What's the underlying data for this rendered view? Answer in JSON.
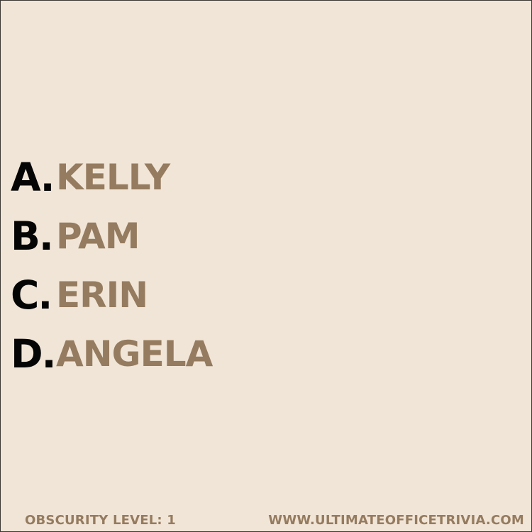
{
  "options": [
    {
      "letter": "A.",
      "answer": "KELLY"
    },
    {
      "letter": "B.",
      "answer": "PAM"
    },
    {
      "letter": "C.",
      "answer": "ERIN"
    },
    {
      "letter": "D.",
      "answer": "ANGELA"
    }
  ],
  "footer": {
    "obscurity": "OBSCURITY LEVEL: 1",
    "website": "WWW.ULTIMATEOFFICETRIVIA.COM"
  },
  "colors": {
    "background": "#f1e5d7",
    "letter": "#050505",
    "accent": "#957b5f",
    "border": "#3a3632"
  }
}
